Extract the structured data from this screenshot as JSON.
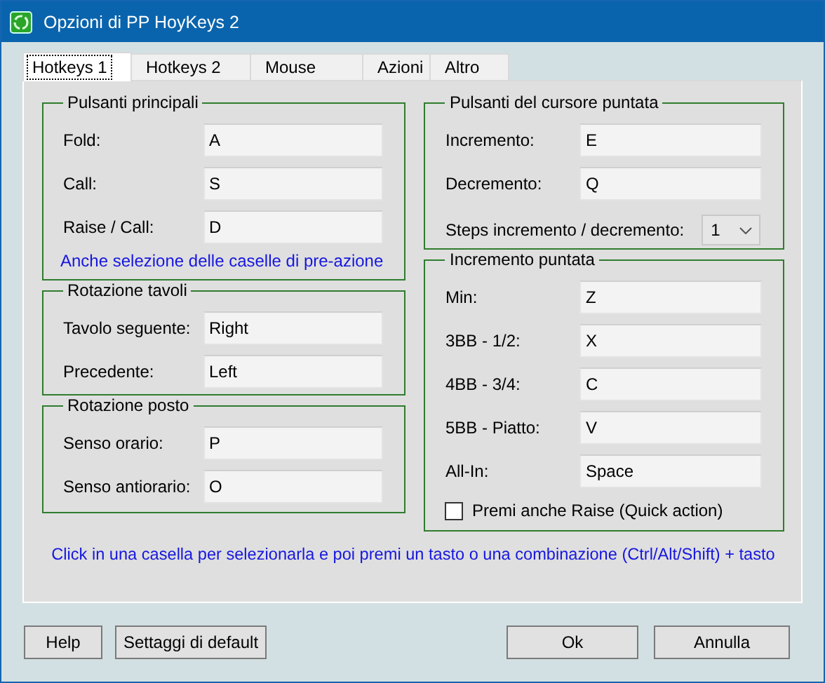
{
  "window": {
    "title": "Opzioni di PP HoyKeys 2"
  },
  "tabs": [
    {
      "label": "Hotkeys 1",
      "selected": true
    },
    {
      "label": "Hotkeys 2",
      "selected": false
    },
    {
      "label": "Mouse",
      "selected": false
    },
    {
      "label": "Azioni",
      "selected": false
    },
    {
      "label": "Altro",
      "selected": false
    }
  ],
  "left_groups": [
    {
      "title": "Pulsanti principali",
      "rows": [
        {
          "kind": "field",
          "label": "Fold:",
          "value": "A"
        },
        {
          "kind": "field",
          "label": "Call:",
          "value": "S"
        },
        {
          "kind": "field",
          "label": "Raise / Call:",
          "value": "D"
        }
      ],
      "note": "Anche selezione delle caselle di pre-azione"
    },
    {
      "title": "Rotazione tavoli",
      "rows": [
        {
          "kind": "field",
          "label": "Tavolo seguente:",
          "value": "Right"
        },
        {
          "kind": "field",
          "label": "Precedente:",
          "value": "Left"
        }
      ]
    },
    {
      "title": "Rotazione posto",
      "rows": [
        {
          "kind": "field",
          "label": "Senso orario:",
          "value": "P"
        },
        {
          "kind": "field",
          "label": "Senso antiorario:",
          "value": "O"
        }
      ]
    }
  ],
  "right_groups": [
    {
      "title": "Pulsanti del cursore puntata",
      "rows": [
        {
          "kind": "field",
          "label": "Incremento:",
          "value": "E"
        },
        {
          "kind": "field",
          "label": "Decremento:",
          "value": "Q"
        },
        {
          "kind": "select",
          "label": "Steps incremento / decremento:",
          "value": "1"
        }
      ]
    },
    {
      "title": "Incremento puntata",
      "rows": [
        {
          "kind": "field",
          "label": "Min:",
          "value": "Z"
        },
        {
          "kind": "field",
          "label": "3BB - 1/2:",
          "value": "X"
        },
        {
          "kind": "field",
          "label": "4BB - 3/4:",
          "value": "C"
        },
        {
          "kind": "field",
          "label": "5BB - Piatto:",
          "value": "V"
        },
        {
          "kind": "field",
          "label": "All-In:",
          "value": "Space"
        },
        {
          "kind": "checkbox",
          "label": "Premi anche Raise (Quick action)",
          "checked": false
        }
      ]
    }
  ],
  "hint": "Click in una casella per selezionarla e poi premi un tasto o una combinazione (Ctrl/Alt/Shift) + tasto",
  "buttons_left": [
    "Help",
    "Settaggi di default"
  ],
  "buttons_right": [
    "Ok",
    "Annulla"
  ]
}
